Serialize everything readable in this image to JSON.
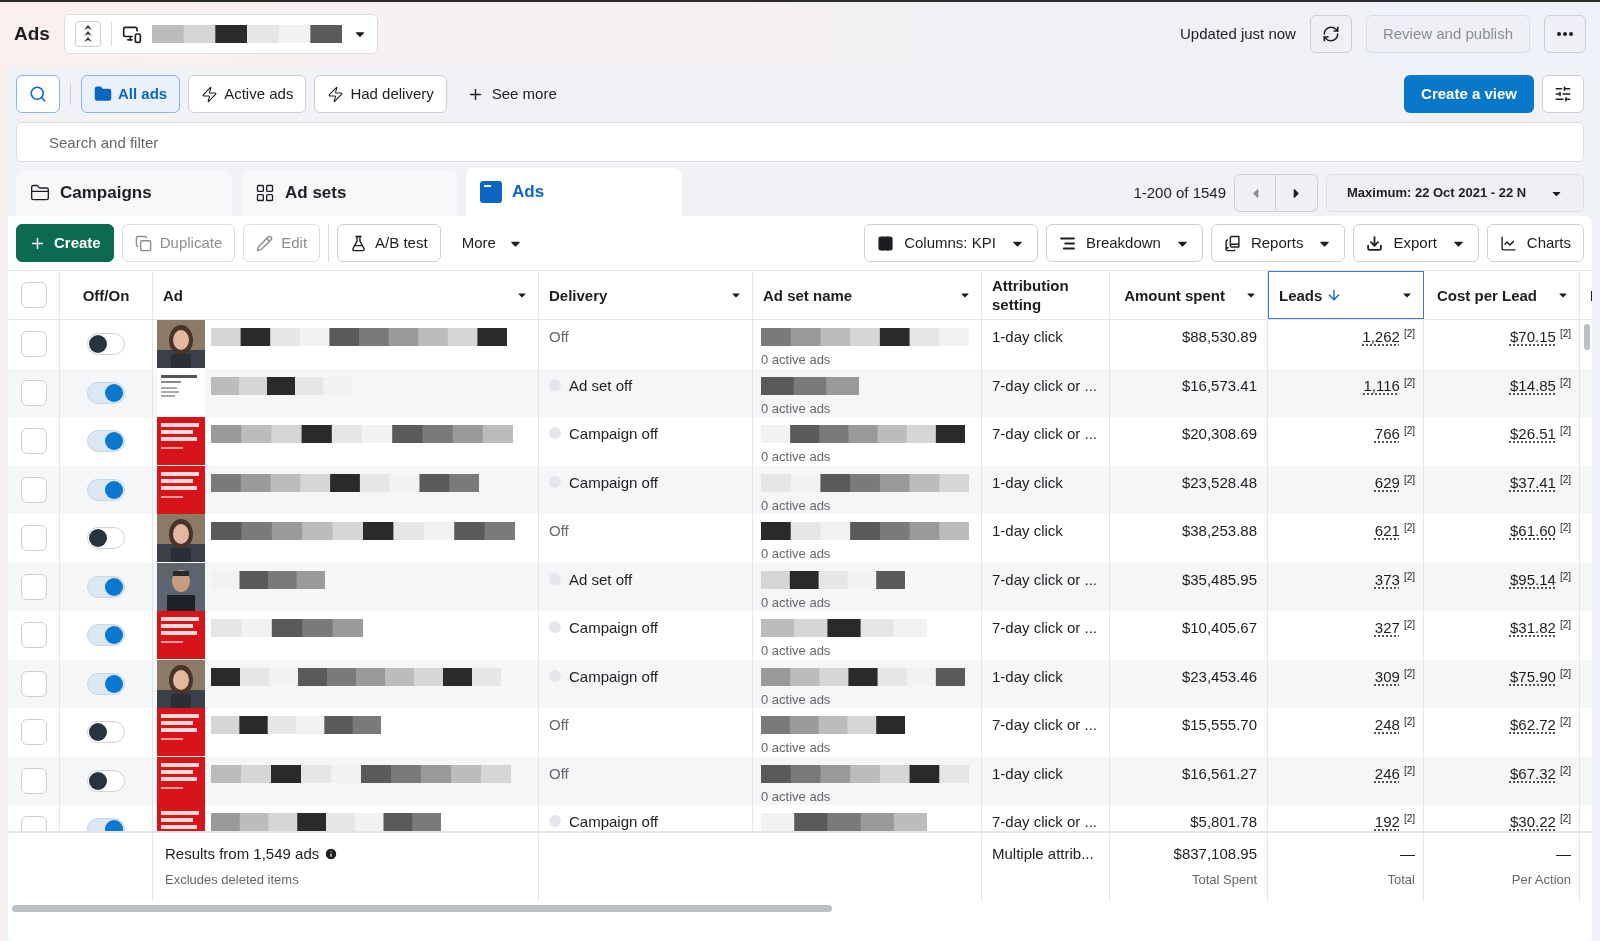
{
  "header": {
    "title": "Ads",
    "status": "Updated just now",
    "publish": {
      "label": "Review and publish",
      "disabled": true
    }
  },
  "filters": {
    "chips": [
      {
        "label": "All ads",
        "kind": "folder",
        "selected": true
      },
      {
        "label": "Active ads",
        "kind": "bolt",
        "selected": false
      },
      {
        "label": "Had delivery",
        "kind": "bolt",
        "selected": false
      }
    ],
    "see_more": "See more",
    "create_view": "Create a view",
    "search_placeholder": "Search and filter"
  },
  "tabs": [
    {
      "label": "Campaigns",
      "kind": "campaigns",
      "selected": false
    },
    {
      "label": "Ad sets",
      "kind": "adsets",
      "selected": false
    },
    {
      "label": "Ads",
      "kind": "ads",
      "selected": true
    }
  ],
  "pagination": {
    "range": "1-200 of 1549",
    "prev_disabled": true,
    "date": "Maximum: 22 Oct 2021 - 22 N"
  },
  "toolbar_left": [
    {
      "label": "Create",
      "kind": "create",
      "disabled": false
    },
    {
      "label": "Duplicate",
      "kind": "duplicate",
      "disabled": true
    },
    {
      "label": "Edit",
      "kind": "edit",
      "disabled": true
    },
    {
      "label": "A/B test",
      "kind": "abtest",
      "disabled": false
    },
    {
      "label": "More",
      "kind": "more",
      "disabled": false
    }
  ],
  "toolbar_right": [
    {
      "label": "Columns: KPI",
      "kind": "columns",
      "caret": true
    },
    {
      "label": "Breakdown",
      "kind": "breakdown",
      "caret": true
    },
    {
      "label": "Reports",
      "kind": "reports",
      "caret": true
    },
    {
      "label": "Export",
      "kind": "export",
      "caret": true
    },
    {
      "label": "Charts",
      "kind": "charts",
      "caret": false
    }
  ],
  "table": {
    "columns": [
      {
        "label": "Off/On",
        "menu": false,
        "sorted": false
      },
      {
        "label": "Ad",
        "menu": true,
        "sorted": false
      },
      {
        "label": "Delivery",
        "menu": true,
        "sorted": false
      },
      {
        "label": "Ad set name",
        "menu": true,
        "sorted": false
      },
      {
        "label": "Attribution setting",
        "menu": false,
        "sorted": false
      },
      {
        "label": "Amount spent",
        "menu": true,
        "sorted": false
      },
      {
        "label": "Leads",
        "menu": true,
        "sorted": true
      },
      {
        "label": "Cost per Lead",
        "menu": true,
        "sorted": false
      },
      {
        "label": "I",
        "sorted": false
      }
    ],
    "select_all_checked": false,
    "rows": [
      {
        "on": false,
        "delivery": "Off",
        "delivery_dot": false,
        "adset_sub": "0 active ads",
        "attribution": "1-day click",
        "spent": "$88,530.89",
        "checked": false,
        "leads": "1,262",
        "leads_note": "[2]",
        "cpl": "$70.15",
        "cpl_note": "[2]"
      },
      {
        "on": true,
        "delivery": "Ad set off",
        "delivery_dot": true,
        "adset_sub": "0 active ads",
        "attribution": "7-day click or ...",
        "spent": "$16,573.41",
        "checked": false,
        "leads": "1,116",
        "leads_note": "[2]",
        "cpl": "$14.85",
        "cpl_note": "[2]"
      },
      {
        "on": true,
        "delivery": "Campaign off",
        "delivery_dot": true,
        "adset_sub": "0 active ads",
        "attribution": "7-day click or ...",
        "spent": "$20,308.69",
        "checked": false,
        "leads": "766",
        "leads_note": "[2]",
        "cpl": "$26.51",
        "cpl_note": "[2]"
      },
      {
        "on": true,
        "delivery": "Campaign off",
        "delivery_dot": true,
        "adset_sub": "0 active ads",
        "attribution": "1-day click",
        "spent": "$23,528.48",
        "checked": false,
        "leads": "629",
        "leads_note": "[2]",
        "cpl": "$37.41",
        "cpl_note": "[2]"
      },
      {
        "on": false,
        "delivery": "Off",
        "delivery_dot": false,
        "adset_sub": "0 active ads",
        "attribution": "1-day click",
        "spent": "$38,253.88",
        "checked": false,
        "leads": "621",
        "leads_note": "[2]",
        "cpl": "$61.60",
        "cpl_note": "[2]"
      },
      {
        "on": true,
        "delivery": "Ad set off",
        "delivery_dot": true,
        "adset_sub": "0 active ads",
        "attribution": "7-day click or ...",
        "spent": "$35,485.95",
        "checked": false,
        "leads": "373",
        "leads_note": "[2]",
        "cpl": "$95.14",
        "cpl_note": "[2]"
      },
      {
        "on": true,
        "delivery": "Campaign off",
        "delivery_dot": true,
        "adset_sub": "0 active ads",
        "attribution": "7-day click or ...",
        "spent": "$10,405.67",
        "checked": false,
        "leads": "327",
        "leads_note": "[2]",
        "cpl": "$31.82",
        "cpl_note": "[2]"
      },
      {
        "on": true,
        "delivery": "Campaign off",
        "delivery_dot": true,
        "adset_sub": "0 active ads",
        "attribution": "1-day click",
        "spent": "$23,453.46",
        "checked": false,
        "leads": "309",
        "leads_note": "[2]",
        "cpl": "$75.90",
        "cpl_note": "[2]"
      },
      {
        "on": false,
        "delivery": "Off",
        "delivery_dot": false,
        "adset_sub": "0 active ads",
        "attribution": "7-day click or ...",
        "spent": "$15,555.70",
        "checked": false,
        "leads": "248",
        "leads_note": "[2]",
        "cpl": "$62.72",
        "cpl_note": "[2]"
      },
      {
        "on": false,
        "delivery": "Off",
        "delivery_dot": false,
        "adset_sub": "0 active ads",
        "attribution": "1-day click",
        "spent": "$16,561.27",
        "checked": false,
        "leads": "246",
        "leads_note": "[2]",
        "cpl": "$67.32",
        "cpl_note": "[2]"
      },
      {
        "on": true,
        "delivery": "Campaign off",
        "delivery_dot": true,
        "attribution": "7-day click or ...",
        "spent": "$5,801.78",
        "checked": false,
        "leads": "192",
        "leads_note": "[2]",
        "cpl": "$30.22",
        "cpl_note": "[2]"
      }
    ],
    "footer": {
      "results": "Results from 1,549 ads",
      "note": "Excludes deleted items",
      "attribution": "Multiple attrib...",
      "spent": "$837,108.95",
      "spent_label": "Total Spent",
      "leads": "—",
      "leads_label": "Total",
      "cpl": "—",
      "cpl_label": "Per Action"
    }
  }
}
